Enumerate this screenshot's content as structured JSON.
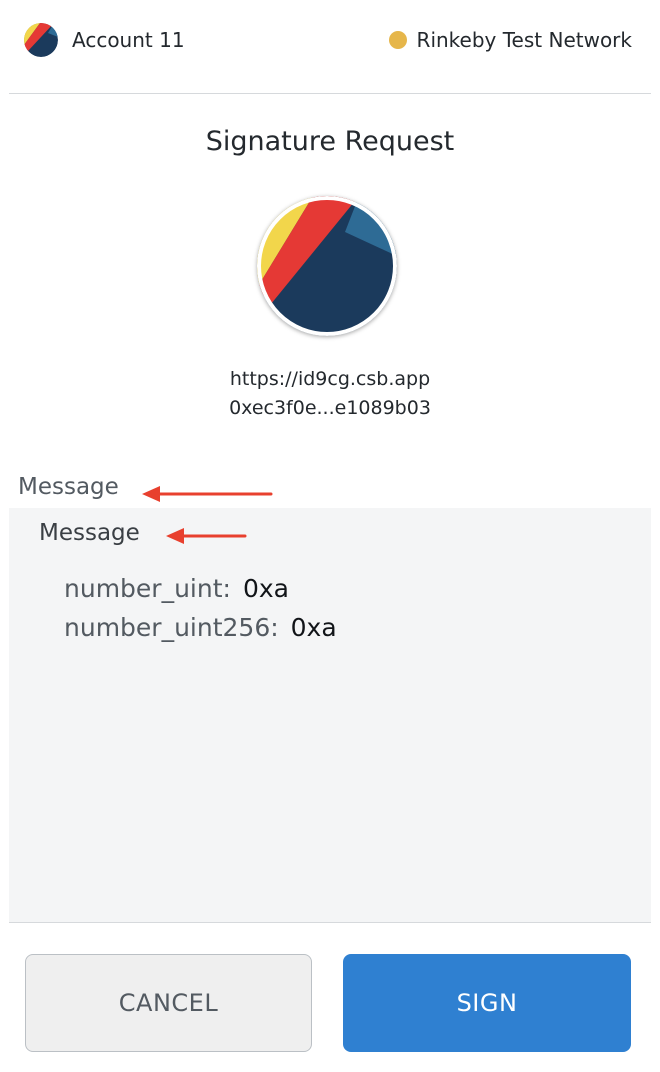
{
  "header": {
    "account_name": "Account 11",
    "network_name": "Rinkeby Test Network",
    "network_color": "#e6b64a"
  },
  "request": {
    "title": "Signature Request",
    "origin_url": "https://id9cg.csb.app",
    "origin_address": "0xec3f0e...e1089b03"
  },
  "message": {
    "heading": "Message",
    "subheading": "Message",
    "fields": [
      {
        "key": "number_uint:",
        "value": "0xa"
      },
      {
        "key": "number_uint256:",
        "value": "0xa"
      }
    ]
  },
  "actions": {
    "cancel_label": "CANCEL",
    "sign_label": "SIGN"
  },
  "colors": {
    "sign_button": "#2f80d1",
    "annotation_arrow": "#e8402e",
    "identicon_navy": "#1b3a5c",
    "identicon_red": "#e53935",
    "identicon_yellow": "#f2d64b",
    "identicon_blue": "#2e6b95"
  },
  "icons": {
    "account_avatar": "identicon",
    "origin_avatar": "identicon",
    "annotation_arrows": "arrow-left-icon"
  }
}
